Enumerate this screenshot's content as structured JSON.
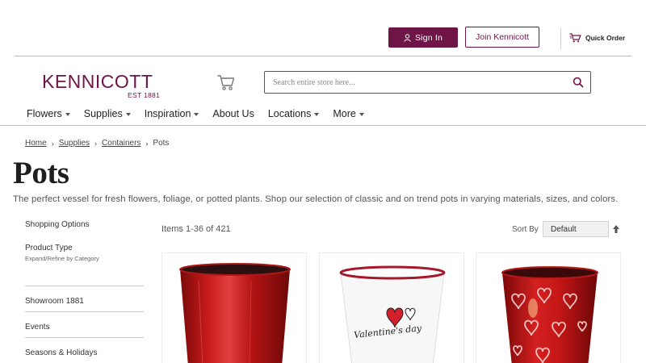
{
  "topbar": {
    "sign_in": "Sign In",
    "join": "Join Kennicott",
    "quick_order": "Quick Order"
  },
  "brand": {
    "name": "KENNICOTT",
    "est": "EST 1881",
    "color": "#6e1447"
  },
  "search": {
    "placeholder": "Search entire store here..."
  },
  "nav": {
    "items": [
      {
        "label": "Flowers",
        "dropdown": true
      },
      {
        "label": "Supplies",
        "dropdown": true
      },
      {
        "label": "Inspiration",
        "dropdown": true
      },
      {
        "label": "About Us",
        "dropdown": false
      },
      {
        "label": "Locations",
        "dropdown": true
      },
      {
        "label": "More",
        "dropdown": true
      }
    ]
  },
  "breadcrumb": {
    "items": [
      "Home",
      "Supplies",
      "Containers"
    ],
    "current": "Pots"
  },
  "page": {
    "title": "Pots",
    "description": "The perfect vessel for fresh flowers, foliage, or potted plants. Shop our selection of classic and on trend pots in varying materials, sizes, and colors."
  },
  "sidebar": {
    "shopping_options": "Shopping Options",
    "product_type": "Product Type",
    "product_type_sub": "Expand/Refine by Category",
    "links": [
      "Showroom 1881",
      "Events",
      "Seasons & Holidays"
    ]
  },
  "toolbar": {
    "items_count": "Items 1-36 of 421",
    "sort_by": "Sort By",
    "sort_value": "Default"
  },
  "products": [
    {
      "icon": "red-metal-pot"
    },
    {
      "icon": "white-valentines-pot",
      "print_text": "Valentine's day"
    },
    {
      "icon": "red-hearts-pot"
    }
  ]
}
